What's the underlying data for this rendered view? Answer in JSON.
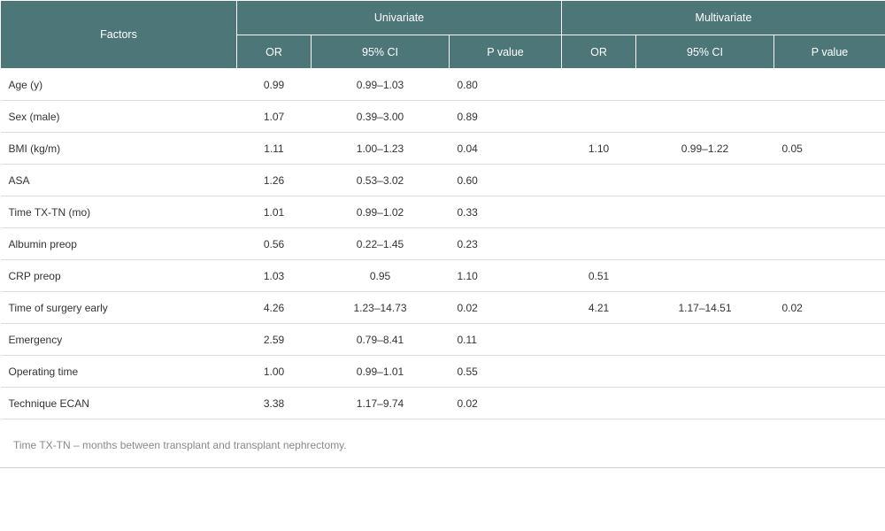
{
  "table": {
    "header": {
      "factors": "Factors",
      "univariate": "Univariate",
      "multivariate": "Multivariate",
      "sub": [
        "OR",
        "95% CI",
        "P value",
        "OR",
        "95% CI",
        "P value"
      ]
    },
    "rows": [
      {
        "factor": "Age (y)",
        "u_or": "0.99",
        "u_ci": "0.99–1.03",
        "u_p": "0.80",
        "m_or": "",
        "m_ci": "",
        "m_p": ""
      },
      {
        "factor": "Sex (male)",
        "u_or": "1.07",
        "u_ci": "0.39–3.00",
        "u_p": "0.89",
        "m_or": "",
        "m_ci": "",
        "m_p": ""
      },
      {
        "factor": "BMI (kg/m)",
        "u_or": "1.11",
        "u_ci": "1.00–1.23",
        "u_p": "0.04",
        "m_or": "1.10",
        "m_ci": "0.99–1.22",
        "m_p": "0.05"
      },
      {
        "factor": "ASA",
        "u_or": "1.26",
        "u_ci": "0.53–3.02",
        "u_p": "0.60",
        "m_or": "",
        "m_ci": "",
        "m_p": ""
      },
      {
        "factor": "Time TX-TN (mo)",
        "u_or": "1.01",
        "u_ci": "0.99–1.02",
        "u_p": "0.33",
        "m_or": "",
        "m_ci": "",
        "m_p": ""
      },
      {
        "factor": "Albumin preop",
        "u_or": "0.56",
        "u_ci": "0.22–1.45",
        "u_p": "0.23",
        "m_or": "",
        "m_ci": "",
        "m_p": ""
      },
      {
        "factor": "CRP preop",
        "u_or": "1.03",
        "u_ci": "0.95",
        "u_p": "1.10",
        "m_or": "0.51",
        "m_ci": "",
        "m_p": ""
      },
      {
        "factor": "Time of surgery early",
        "u_or": "4.26",
        "u_ci": "1.23–14.73",
        "u_p": "0.02",
        "m_or": "4.21",
        "m_ci": "1.17–14.51",
        "m_p": "0.02"
      },
      {
        "factor": "Emergency",
        "u_or": "2.59",
        "u_ci": "0.79–8.41",
        "u_p": "0.11",
        "m_or": "",
        "m_ci": "",
        "m_p": ""
      },
      {
        "factor": "Operating time",
        "u_or": "1.00",
        "u_ci": "0.99–1.01",
        "u_p": "0.55",
        "m_or": "",
        "m_ci": "",
        "m_p": ""
      },
      {
        "factor": "Technique ECAN",
        "u_or": "3.38",
        "u_ci": "1.17–9.74",
        "u_p": "0.02",
        "m_or": "",
        "m_ci": "",
        "m_p": ""
      }
    ],
    "footnote": "Time TX-TN – months between transplant and transplant nephrectomy."
  },
  "colors": {
    "header_bg": "#4d7679",
    "header_text": "#ffffff",
    "row_border": "#dcdcdc",
    "footnote_text": "#8a8a8a"
  }
}
